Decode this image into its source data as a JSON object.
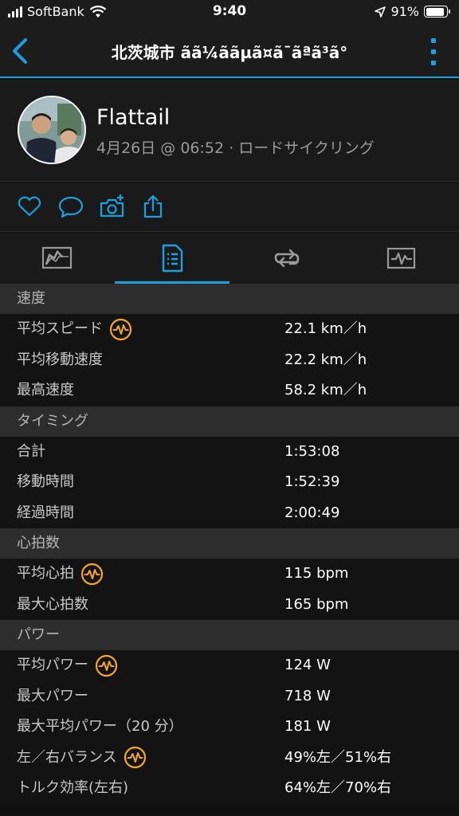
{
  "status_bar": {
    "carrier": "SoftBank",
    "time": "9:40",
    "battery": "91%"
  },
  "header": {
    "title": "北茨城市 ãã¼ããµã¤ã¯ãªã³ã°"
  },
  "profile": {
    "name": "Flattail",
    "meta": "4月26日 @ 06:52 · ロードサイクリング"
  },
  "icons": {
    "accent": "#1a9fdf",
    "highlight": "#f5a623",
    "social": [
      "heart-icon",
      "comment-icon",
      "add-photo-icon",
      "share-icon"
    ],
    "tabs": [
      "overview-map-icon",
      "stats-list-icon",
      "laps-icon",
      "charts-icon"
    ],
    "comparison": "heart-rate-compare-icon"
  },
  "sections": [
    {
      "title": "速度",
      "rows": [
        {
          "label": "平均スピード",
          "value": "22.1 km／h",
          "badge": true
        },
        {
          "label": "平均移動速度",
          "value": "22.2 km／h",
          "badge": false
        },
        {
          "label": "最高速度",
          "value": "58.2 km／h",
          "badge": false
        }
      ]
    },
    {
      "title": "タイミング",
      "rows": [
        {
          "label": "合計",
          "value": "1:53:08",
          "badge": false
        },
        {
          "label": "移動時間",
          "value": "1:52:39",
          "badge": false
        },
        {
          "label": "経過時間",
          "value": "2:00:49",
          "badge": false
        }
      ]
    },
    {
      "title": "心拍数",
      "rows": [
        {
          "label": "平均心拍",
          "value": "115 bpm",
          "badge": true
        },
        {
          "label": "最大心拍数",
          "value": "165 bpm",
          "badge": false
        }
      ]
    },
    {
      "title": "パワー",
      "rows": [
        {
          "label": "平均パワー",
          "value": "124 W",
          "badge": true
        },
        {
          "label": "最大パワー",
          "value": "718 W",
          "badge": false
        },
        {
          "label": "最大平均パワー（20 分）",
          "value": "181 W",
          "badge": false
        },
        {
          "label": "左／右バランス",
          "value": "49%左／51%右",
          "badge": true
        },
        {
          "label": "トルク効率(左右)",
          "value": "64%左／70%右",
          "badge": false
        }
      ]
    }
  ]
}
